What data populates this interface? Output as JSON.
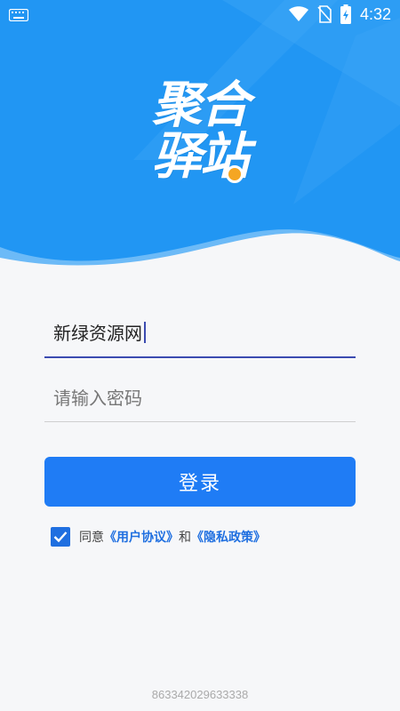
{
  "status_bar": {
    "time": "4:32",
    "icons": [
      "keyboard-icon",
      "wifi-icon",
      "no-sim-icon",
      "battery-charging-icon"
    ]
  },
  "logo": {
    "line1": "聚合",
    "line2": "驿站"
  },
  "form": {
    "username_value": "新绿资源网",
    "password_placeholder": "请输入密码",
    "login_label": "登录"
  },
  "agreement": {
    "checked": true,
    "prefix": "同意",
    "user_agreement": "《用户协议》",
    "and": "和",
    "privacy_policy": "《隐私政策》"
  },
  "device_id": "863342029633338",
  "colors": {
    "primary": "#1f7cf5",
    "header": "#2196f3",
    "link": "#1f6fe0"
  }
}
